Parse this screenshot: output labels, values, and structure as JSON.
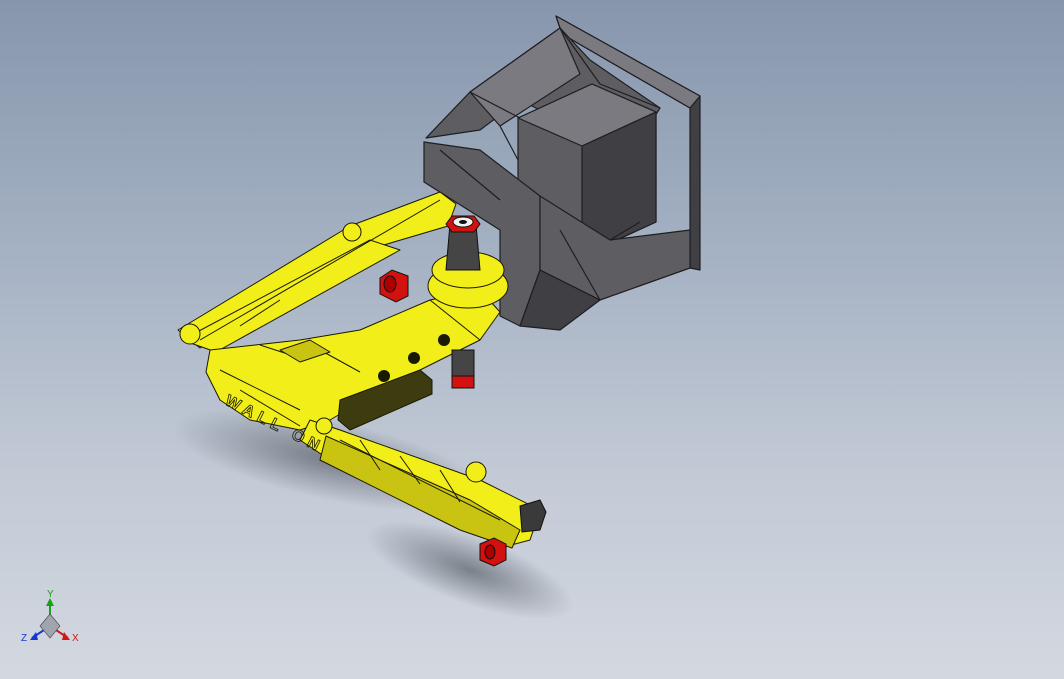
{
  "viewport": {
    "background_top": "#8796ad",
    "background_bottom": "#d3d8e0"
  },
  "model": {
    "arm_color": "#f2ee1a",
    "edge_color": "#1a1a00",
    "mount_color": "#5e5e62",
    "mount_light": "#7a7a80",
    "mount_dark": "#3f3f44",
    "fastener_color": "#d41111",
    "arm_text": "WALL ON"
  },
  "triad": {
    "x_label": "X",
    "y_label": "Y",
    "z_label": "Z",
    "x_color": "#d01818",
    "y_color": "#18a018",
    "z_color": "#1838d0"
  }
}
